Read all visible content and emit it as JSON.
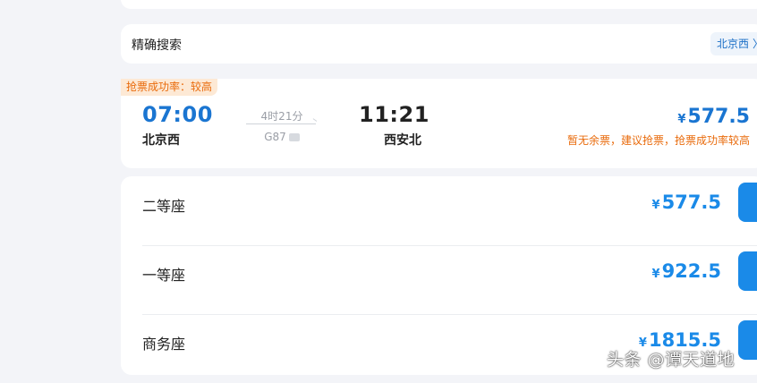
{
  "search": {
    "label": "精确搜索",
    "station_chip": "北京西",
    "chip_chevron": "〉"
  },
  "train": {
    "success_badge": "抢票成功率：较高",
    "departure_time": "07:00",
    "departure_station": "北京西",
    "duration": "4时21分",
    "train_number": "G87",
    "arrival_time": "11:21",
    "arrival_station": "西安北",
    "currency": "¥",
    "lowest_price": "577.5",
    "ticket_note": "暂无余票，建议抢票，抢票成功率较高"
  },
  "seats": [
    {
      "name": "二等座",
      "currency": "¥",
      "price": "577.5"
    },
    {
      "name": "一等座",
      "currency": "¥",
      "price": "922.5"
    },
    {
      "name": "商务座",
      "currency": "¥",
      "price": "1815.5"
    }
  ],
  "watermark": "头条 @谭天道地",
  "colors": {
    "accent_blue": "#1a75d1",
    "button_blue": "#1a8ae8",
    "warning_orange": "#e96b0c",
    "page_bg": "#f3f4f8"
  },
  "icons": {
    "train_tag": "ticket-tag-icon"
  }
}
